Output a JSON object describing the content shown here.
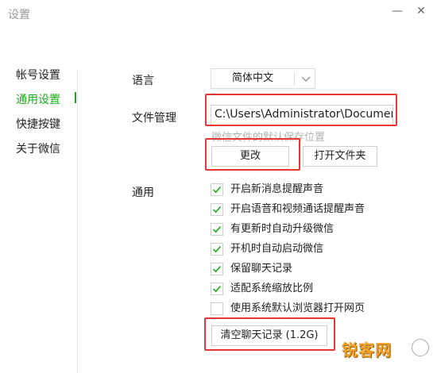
{
  "window": {
    "title": "设置",
    "minimize_glyph": "—",
    "close_glyph": "✕"
  },
  "sidebar": {
    "items": [
      {
        "label": "帐号设置",
        "active": false
      },
      {
        "label": "通用设置",
        "active": true
      },
      {
        "label": "快捷按键",
        "active": false
      },
      {
        "label": "关于微信",
        "active": false
      }
    ]
  },
  "language": {
    "label": "语言",
    "value": "简体中文"
  },
  "file_management": {
    "label": "文件管理",
    "path": "C:\\Users\\Administrator\\Documents\\WeChat Files",
    "hint": "微信文件的默认保存位置",
    "change_button": "更改",
    "open_folder_button": "打开文件夹"
  },
  "general": {
    "label": "通用",
    "options": [
      {
        "label": "开启新消息提醒声音",
        "checked": true
      },
      {
        "label": "开启语音和视频通话提醒声音",
        "checked": true
      },
      {
        "label": "有更新时自动升级微信",
        "checked": true
      },
      {
        "label": "开机时自动启动微信",
        "checked": true
      },
      {
        "label": "保留聊天记录",
        "checked": true
      },
      {
        "label": "适配系统缩放比例",
        "checked": true
      },
      {
        "label": "使用系统默认浏览器打开网页",
        "checked": false
      }
    ],
    "clear_history_button": "清空聊天记录 (1.2G)"
  },
  "watermark": {
    "text": "锐客网"
  },
  "colors": {
    "accent": "#1aad19",
    "highlight": "#e53935",
    "hint": "#b4b4b4"
  }
}
